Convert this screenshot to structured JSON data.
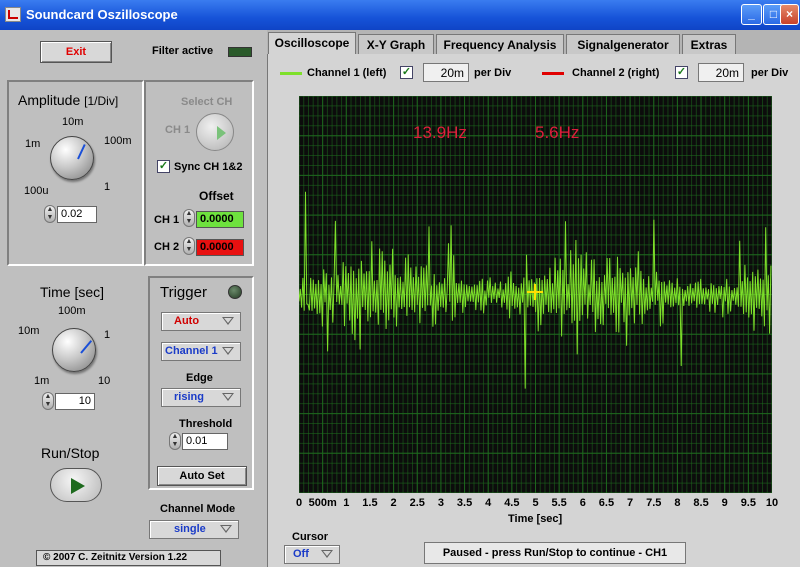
{
  "window": {
    "title": "Soundcard Oszilloscope",
    "colors": {
      "titlebar": "#1653d8",
      "trace_ch1": "#7ee02a",
      "trace_ch2": "#e00000",
      "scope_bg": "#0c0c0c",
      "grid": "#1e6a1e",
      "freq_text": "#e01e3c"
    }
  },
  "controls": {
    "exit_label": "Exit",
    "filter_label": "Filter active",
    "amplitude": {
      "title": "Amplitude",
      "unit": "[1/Div]",
      "dial_labels": [
        "10m",
        "1m",
        "100m",
        "100u",
        "1"
      ],
      "value": "0.02"
    },
    "select_ch": {
      "label": "Select CH",
      "ch_label": "CH 1"
    },
    "sync": {
      "label": "Sync CH 1&2",
      "checked": "✓"
    },
    "offset": {
      "label": "Offset",
      "ch1_label": "CH 1",
      "ch1_value": "0.0000",
      "ch2_label": "CH 2",
      "ch2_value": "0.0000"
    },
    "time": {
      "title": "Time [sec]",
      "dial_labels": [
        "100m",
        "10m",
        "1",
        "1m",
        "10"
      ],
      "value": "10"
    },
    "trigger": {
      "title": "Trigger",
      "mode": "Auto",
      "channel": "Channel 1",
      "edge_label": "Edge",
      "edge": "rising",
      "threshold_label": "Threshold",
      "threshold": "0.01",
      "autoset_label": "Auto Set"
    },
    "run_stop_label": "Run/Stop",
    "channel_mode": {
      "label": "Channel Mode",
      "value": "single"
    },
    "copyright": "© 2007   C. Zeitnitz Version 1.22"
  },
  "tabs": [
    {
      "label": "Oscilloscope"
    },
    {
      "label": "X-Y Graph"
    },
    {
      "label": "Frequency Analysis"
    },
    {
      "label": "Signalgenerator"
    },
    {
      "label": "Extras"
    }
  ],
  "scope": {
    "channel1": {
      "label": "Channel 1 (left)",
      "checked": "✓",
      "per_div_value": "20m",
      "per_div_label": "per Div"
    },
    "channel2": {
      "label": "Channel 2 (right)",
      "checked": "✓",
      "per_div_value": "20m",
      "per_div_label": "per Div"
    },
    "freq_ch1": "13.9Hz",
    "freq_ch2": "5.6Hz",
    "x_axis": {
      "label": "Time [sec]",
      "ticks": [
        "0",
        "500m",
        "1",
        "1.5",
        "2",
        "2.5",
        "3",
        "3.5",
        "4",
        "4.5",
        "5",
        "5.5",
        "6",
        "6.5",
        "7",
        "7.5",
        "8",
        "8.5",
        "9",
        "9.5",
        "10"
      ]
    },
    "cursor_label": "Cursor",
    "cursor_value": "Off",
    "status": "Paused - press Run/Stop to continue - CH1"
  }
}
